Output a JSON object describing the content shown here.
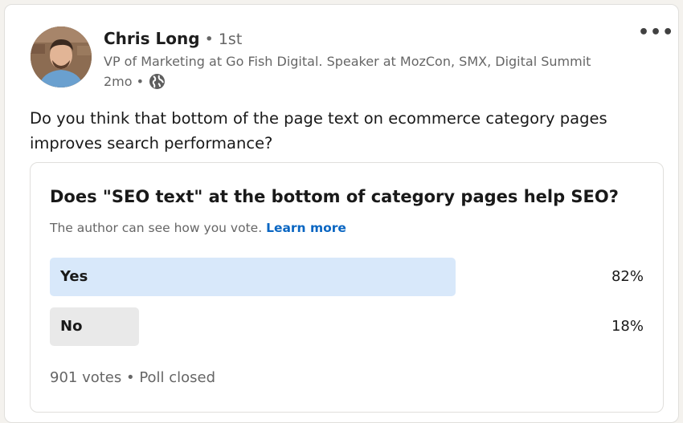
{
  "colors": {
    "winning_bar": "#d8e8fa",
    "losing_bar": "#e9e9e9",
    "link": "#0a66c2",
    "secondary_text": "#666666"
  },
  "author": {
    "name": "Chris Long",
    "degree": " • 1st",
    "headline": "VP of Marketing at Go Fish Digital. Speaker at MozCon, SMX, Digital Summit",
    "time": "2mo •",
    "visibility_icon": "globe-icon"
  },
  "menu": {
    "icon": "more-options-icon",
    "label": "•••"
  },
  "post": {
    "text": "Do you think that bottom of the page text on ecommerce category pages improves search performance?"
  },
  "poll": {
    "question": "Does \"SEO text\" at the bottom of category pages help SEO?",
    "note": "The author can see how you vote.",
    "learn_more": "Learn more",
    "options": [
      {
        "label": "Yes",
        "percent_text": "82%",
        "share": 0.82
      },
      {
        "label": "No",
        "percent_text": "18%",
        "share": 0.18
      }
    ],
    "footer": "901 votes • Poll closed"
  }
}
